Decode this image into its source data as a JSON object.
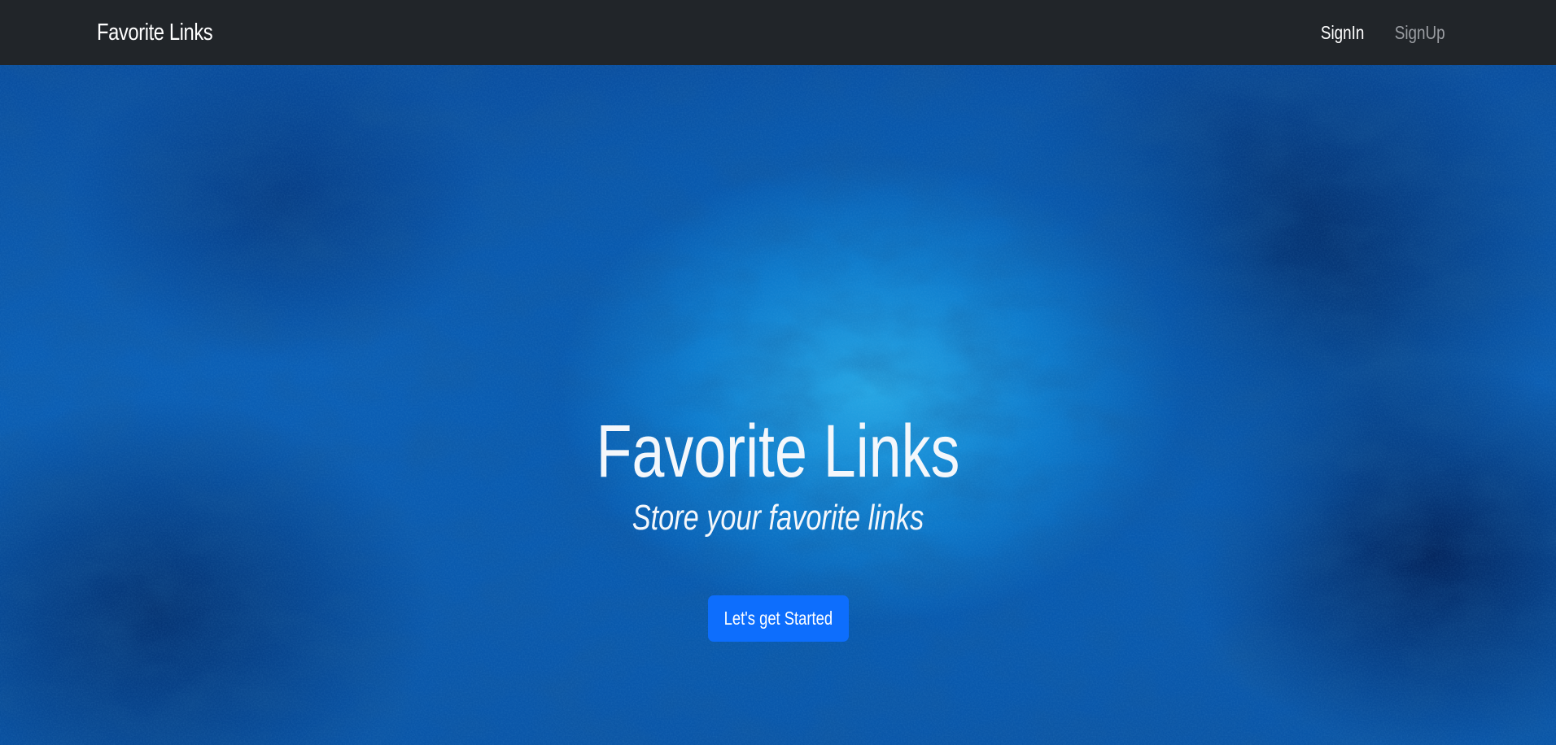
{
  "navbar": {
    "brand": "Favorite Links",
    "links": [
      {
        "label": "SignIn"
      },
      {
        "label": "SignUp"
      }
    ]
  },
  "hero": {
    "title": "Favorite Links",
    "subtitle": "Store your favorite links",
    "cta_label": "Let's get Started"
  },
  "colors": {
    "navbar_bg": "#212529",
    "button_bg": "#0d6efd",
    "hero_bg": "#0b5fb5",
    "muted_link": "#9a9da2"
  }
}
